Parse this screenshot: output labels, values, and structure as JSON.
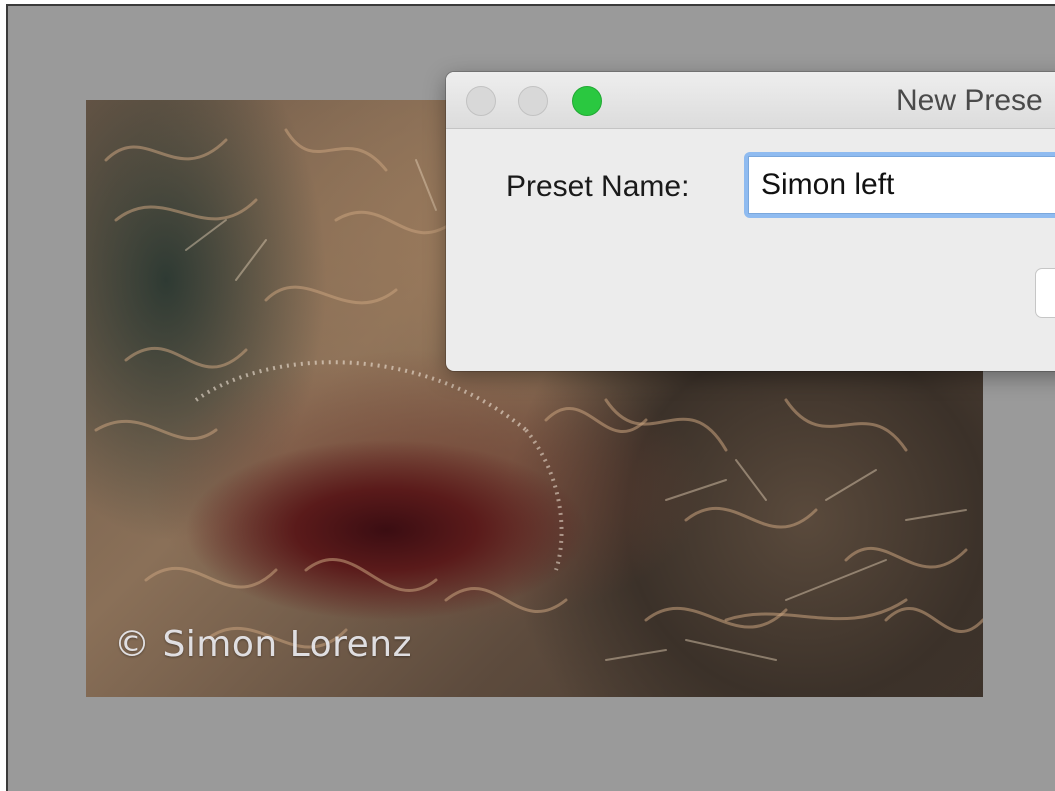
{
  "photo": {
    "watermark": "© Simon Lorenz"
  },
  "dialog": {
    "title": "New Prese",
    "preset_name_label": "Preset Name:",
    "preset_name_value": "Simon left"
  },
  "colors": {
    "zoom_button": "#2ac840",
    "focus_ring": "#8fbbf0"
  },
  "icons": {
    "close": "window-close-icon",
    "minimize": "window-minimize-icon",
    "zoom": "window-zoom-icon"
  }
}
